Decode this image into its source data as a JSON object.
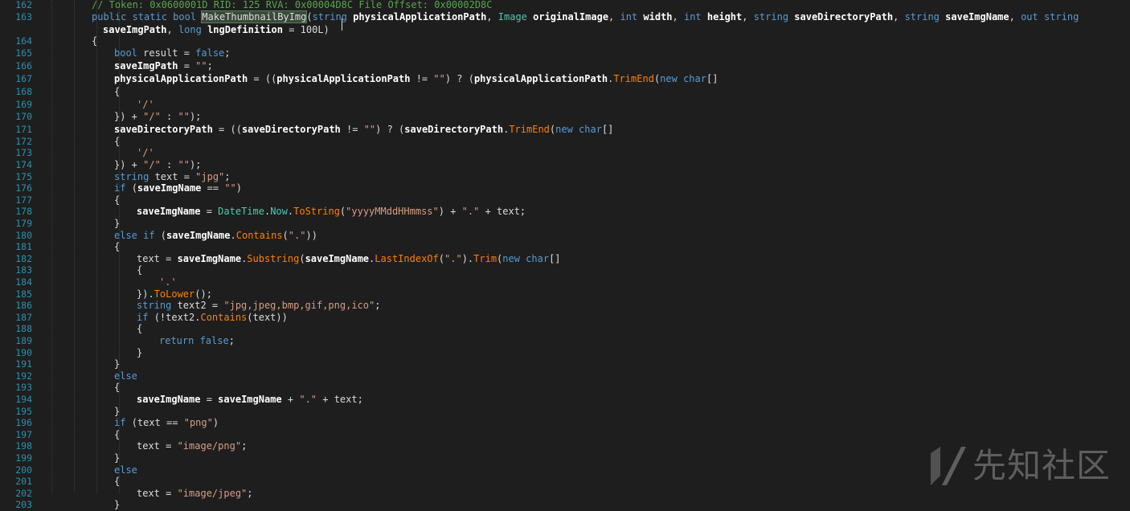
{
  "lines": [
    {
      "n": "162",
      "indent": 2,
      "segs": [
        [
          "cm",
          "// Token: 0x0600001D RID: 125 RVA: 0x00004D8C File Offset: 0x00002D8C"
        ]
      ]
    },
    {
      "n": "163",
      "indent": 2,
      "segs": [
        [
          "kw",
          "public static bool "
        ],
        [
          "hl",
          "MakeThumbnailByImg"
        ],
        [
          "op",
          "("
        ],
        [
          "kw",
          "string "
        ],
        [
          "pv",
          "physicalApplicationPath"
        ],
        [
          "op",
          ", "
        ],
        [
          "ty",
          "Image "
        ],
        [
          "pv",
          "originalImage"
        ],
        [
          "op",
          ", "
        ],
        [
          "kw",
          "int "
        ],
        [
          "pv",
          "width"
        ],
        [
          "op",
          ", "
        ],
        [
          "kw",
          "int "
        ],
        [
          "pv",
          "height"
        ],
        [
          "op",
          ", "
        ],
        [
          "kw",
          "string "
        ],
        [
          "pv",
          "saveDirectoryPath"
        ],
        [
          "op",
          ", "
        ],
        [
          "kw",
          "string "
        ],
        [
          "pv",
          "saveImgName"
        ],
        [
          "op",
          ", "
        ],
        [
          "kw",
          "out string"
        ]
      ]
    },
    {
      "n": "",
      "indent": 2,
      "extra": 14,
      "segs": [
        [
          "pv",
          "saveImgPath"
        ],
        [
          "op",
          ", "
        ],
        [
          "kw",
          "long "
        ],
        [
          "pv",
          "lngDefinition"
        ],
        [
          "op",
          " = 100L)"
        ]
      ]
    },
    {
      "n": "164",
      "indent": 2,
      "segs": [
        [
          "op",
          "{"
        ]
      ]
    },
    {
      "n": "165",
      "indent": 3,
      "segs": [
        [
          "kw",
          "bool "
        ],
        [
          "op",
          "result = "
        ],
        [
          "kw",
          "false"
        ],
        [
          "op",
          ";"
        ]
      ]
    },
    {
      "n": "166",
      "indent": 3,
      "segs": [
        [
          "pv",
          "saveImgPath"
        ],
        [
          "op",
          " = "
        ],
        [
          "st",
          "\"\""
        ],
        [
          "op",
          ";"
        ]
      ]
    },
    {
      "n": "167",
      "indent": 3,
      "segs": [
        [
          "pv",
          "physicalApplicationPath"
        ],
        [
          "op",
          " = (("
        ],
        [
          "pv",
          "physicalApplicationPath"
        ],
        [
          "op",
          " != "
        ],
        [
          "st",
          "\"\""
        ],
        [
          "op",
          ") ? ("
        ],
        [
          "pv",
          "physicalApplicationPath"
        ],
        [
          "op",
          "."
        ],
        [
          "mt",
          "TrimEnd"
        ],
        [
          "op",
          "("
        ],
        [
          "kw",
          "new char"
        ],
        [
          "op",
          "[]"
        ]
      ]
    },
    {
      "n": "168",
      "indent": 3,
      "segs": [
        [
          "op",
          "{"
        ]
      ]
    },
    {
      "n": "169",
      "indent": 4,
      "segs": [
        [
          "st",
          "'/'"
        ]
      ]
    },
    {
      "n": "170",
      "indent": 3,
      "segs": [
        [
          "op",
          "}) + "
        ],
        [
          "st",
          "\"/\""
        ],
        [
          "op",
          " : "
        ],
        [
          "st",
          "\"\""
        ],
        [
          "op",
          ");"
        ]
      ]
    },
    {
      "n": "171",
      "indent": 3,
      "segs": [
        [
          "pv",
          "saveDirectoryPath"
        ],
        [
          "op",
          " = (("
        ],
        [
          "pv",
          "saveDirectoryPath"
        ],
        [
          "op",
          " != "
        ],
        [
          "st",
          "\"\""
        ],
        [
          "op",
          ") ? ("
        ],
        [
          "pv",
          "saveDirectoryPath"
        ],
        [
          "op",
          "."
        ],
        [
          "mt",
          "TrimEnd"
        ],
        [
          "op",
          "("
        ],
        [
          "kw",
          "new char"
        ],
        [
          "op",
          "[]"
        ]
      ]
    },
    {
      "n": "172",
      "indent": 3,
      "segs": [
        [
          "op",
          "{"
        ]
      ]
    },
    {
      "n": "173",
      "indent": 4,
      "segs": [
        [
          "st",
          "'/'"
        ]
      ]
    },
    {
      "n": "174",
      "indent": 3,
      "segs": [
        [
          "op",
          "}) + "
        ],
        [
          "st",
          "\"/\""
        ],
        [
          "op",
          " : "
        ],
        [
          "st",
          "\"\""
        ],
        [
          "op",
          ");"
        ]
      ]
    },
    {
      "n": "175",
      "indent": 3,
      "segs": [
        [
          "kw",
          "string "
        ],
        [
          "op",
          "text = "
        ],
        [
          "st",
          "\"jpg\""
        ],
        [
          "op",
          ";"
        ]
      ]
    },
    {
      "n": "176",
      "indent": 3,
      "segs": [
        [
          "kw",
          "if "
        ],
        [
          "op",
          "("
        ],
        [
          "pv",
          "saveImgName"
        ],
        [
          "op",
          " == "
        ],
        [
          "st",
          "\"\""
        ],
        [
          "op",
          ")"
        ]
      ]
    },
    {
      "n": "177",
      "indent": 3,
      "segs": [
        [
          "op",
          "{"
        ]
      ]
    },
    {
      "n": "178",
      "indent": 4,
      "segs": [
        [
          "pv",
          "saveImgName"
        ],
        [
          "op",
          " = "
        ],
        [
          "ty",
          "DateTime"
        ],
        [
          "op",
          "."
        ],
        [
          "ty",
          "Now"
        ],
        [
          "op",
          "."
        ],
        [
          "mt",
          "ToString"
        ],
        [
          "op",
          "("
        ],
        [
          "st",
          "\"yyyyMMddHHmmss\""
        ],
        [
          "op",
          ") + "
        ],
        [
          "st",
          "\".\""
        ],
        [
          "op",
          " + text;"
        ]
      ]
    },
    {
      "n": "179",
      "indent": 3,
      "segs": [
        [
          "op",
          "}"
        ]
      ]
    },
    {
      "n": "180",
      "indent": 3,
      "segs": [
        [
          "kw",
          "else if "
        ],
        [
          "op",
          "("
        ],
        [
          "pv",
          "saveImgName"
        ],
        [
          "op",
          "."
        ],
        [
          "mt",
          "Contains"
        ],
        [
          "op",
          "("
        ],
        [
          "st",
          "\".\""
        ],
        [
          "op",
          "))"
        ]
      ]
    },
    {
      "n": "181",
      "indent": 3,
      "segs": [
        [
          "op",
          "{"
        ]
      ]
    },
    {
      "n": "182",
      "indent": 4,
      "segs": [
        [
          "op",
          "text = "
        ],
        [
          "pv",
          "saveImgName"
        ],
        [
          "op",
          "."
        ],
        [
          "mt",
          "Substring"
        ],
        [
          "op",
          "("
        ],
        [
          "pv",
          "saveImgName"
        ],
        [
          "op",
          "."
        ],
        [
          "mt",
          "LastIndexOf"
        ],
        [
          "op",
          "("
        ],
        [
          "st",
          "\".\""
        ],
        [
          "op",
          ")."
        ],
        [
          "mt",
          "Trim"
        ],
        [
          "op",
          "("
        ],
        [
          "kw",
          "new char"
        ],
        [
          "op",
          "[]"
        ]
      ]
    },
    {
      "n": "183",
      "indent": 4,
      "segs": [
        [
          "op",
          "{"
        ]
      ]
    },
    {
      "n": "184",
      "indent": 5,
      "segs": [
        [
          "st",
          "'.'"
        ]
      ]
    },
    {
      "n": "185",
      "indent": 4,
      "segs": [
        [
          "op",
          "})."
        ],
        [
          "mt",
          "ToLower"
        ],
        [
          "op",
          "();"
        ]
      ]
    },
    {
      "n": "186",
      "indent": 4,
      "segs": [
        [
          "kw",
          "string "
        ],
        [
          "op",
          "text2 = "
        ],
        [
          "st",
          "\"jpg,jpeg,bmp,gif,png,ico\""
        ],
        [
          "op",
          ";"
        ]
      ]
    },
    {
      "n": "187",
      "indent": 4,
      "segs": [
        [
          "kw",
          "if "
        ],
        [
          "op",
          "(!text2."
        ],
        [
          "mt",
          "Contains"
        ],
        [
          "op",
          "(text))"
        ]
      ]
    },
    {
      "n": "188",
      "indent": 4,
      "segs": [
        [
          "op",
          "{"
        ]
      ]
    },
    {
      "n": "189",
      "indent": 5,
      "segs": [
        [
          "kw",
          "return false"
        ],
        [
          "op",
          ";"
        ]
      ]
    },
    {
      "n": "190",
      "indent": 4,
      "segs": [
        [
          "op",
          "}"
        ]
      ]
    },
    {
      "n": "191",
      "indent": 3,
      "segs": [
        [
          "op",
          "}"
        ]
      ]
    },
    {
      "n": "192",
      "indent": 3,
      "segs": [
        [
          "kw",
          "else"
        ]
      ]
    },
    {
      "n": "193",
      "indent": 3,
      "segs": [
        [
          "op",
          "{"
        ]
      ]
    },
    {
      "n": "194",
      "indent": 4,
      "segs": [
        [
          "pv",
          "saveImgName"
        ],
        [
          "op",
          " = "
        ],
        [
          "pv",
          "saveImgName"
        ],
        [
          "op",
          " + "
        ],
        [
          "st",
          "\".\""
        ],
        [
          "op",
          " + text;"
        ]
      ]
    },
    {
      "n": "195",
      "indent": 3,
      "segs": [
        [
          "op",
          "}"
        ]
      ]
    },
    {
      "n": "196",
      "indent": 3,
      "segs": [
        [
          "kw",
          "if "
        ],
        [
          "op",
          "(text == "
        ],
        [
          "st",
          "\"png\""
        ],
        [
          "op",
          ")"
        ]
      ]
    },
    {
      "n": "197",
      "indent": 3,
      "segs": [
        [
          "op",
          "{"
        ]
      ]
    },
    {
      "n": "198",
      "indent": 4,
      "segs": [
        [
          "op",
          "text = "
        ],
        [
          "st",
          "\"image/png\""
        ],
        [
          "op",
          ";"
        ]
      ]
    },
    {
      "n": "199",
      "indent": 3,
      "segs": [
        [
          "op",
          "}"
        ]
      ]
    },
    {
      "n": "200",
      "indent": 3,
      "segs": [
        [
          "kw",
          "else"
        ]
      ]
    },
    {
      "n": "201",
      "indent": 3,
      "segs": [
        [
          "op",
          "{"
        ]
      ]
    },
    {
      "n": "202",
      "indent": 4,
      "segs": [
        [
          "op",
          "text = "
        ],
        [
          "st",
          "\"image/jpeg\""
        ],
        [
          "op",
          ";"
        ]
      ]
    },
    {
      "n": "203",
      "indent": 3,
      "segs": [
        [
          "op",
          "}"
        ]
      ]
    }
  ],
  "watermark": {
    "text": "先知社区",
    "icon": "xianzhi-logo-icon"
  },
  "colors": {
    "background": "#1e1e1e",
    "keyword": "#569cd6",
    "type": "#4ec9b0",
    "string": "#d69d85",
    "method": "#ff8000",
    "comment": "#57a64a",
    "line_number": "#2b91af"
  }
}
